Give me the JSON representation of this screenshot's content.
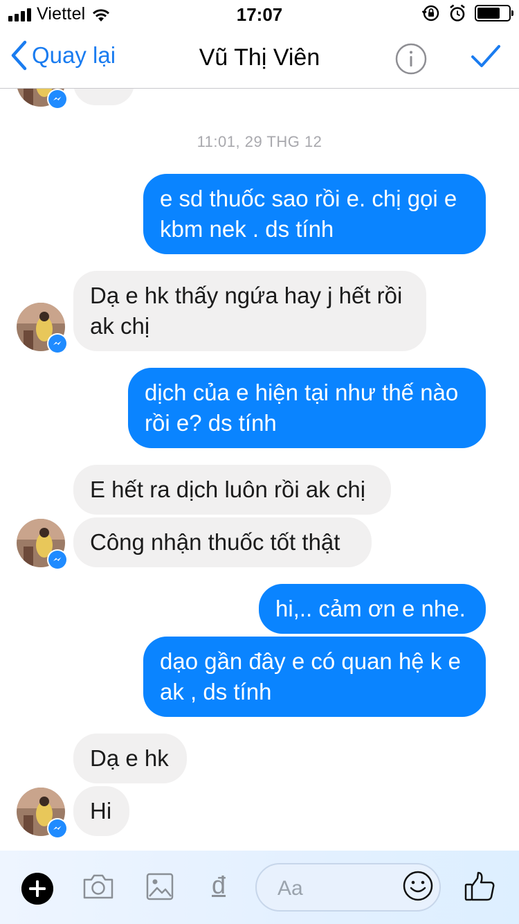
{
  "status_bar": {
    "carrier": "Viettel",
    "time": "17:07",
    "battery_level": 0.72
  },
  "nav": {
    "back_label": "Quay lại",
    "title": "Vũ Thị Viên"
  },
  "chat": {
    "timestamp": "11:01, 29 THG 12",
    "messages": [
      {
        "from": "me",
        "lines": [
          "e sd thuốc sao rồi e. chị gọi e",
          "kbm nek . ds tính"
        ]
      },
      {
        "from": "them",
        "lines": [
          "Dạ e hk thấy ngứa hay j hết rồi",
          "ak chị"
        ]
      },
      {
        "from": "me",
        "lines": [
          "dịch của e hiện tại như thế nào",
          "rồi e? ds tính"
        ]
      },
      {
        "from": "them",
        "lines": [
          "E hết ra dịch luôn rồi ak chị"
        ]
      },
      {
        "from": "them",
        "lines": [
          "Công nhận thuốc tốt thật"
        ]
      },
      {
        "from": "me",
        "lines": [
          "hi,.. cảm ơn e nhe."
        ]
      },
      {
        "from": "me",
        "lines": [
          "dạo gần đây e có quan hệ k e",
          "ak , ds tính"
        ]
      },
      {
        "from": "them",
        "lines": [
          "Dạ e hk"
        ]
      },
      {
        "from": "them",
        "lines": [
          "Hi"
        ]
      }
    ]
  },
  "composer": {
    "placeholder": "Aa",
    "currency_glyph": "đ",
    "icons": [
      "plus-icon",
      "camera-icon",
      "image-icon",
      "currency-icon",
      "emoji-icon",
      "thumbs-up-icon"
    ]
  },
  "colors": {
    "accent": "#1a7cf0",
    "my_bubble": "#0a84ff",
    "their_bubble": "#f1f0f0",
    "timestamp": "#a8a8ad"
  }
}
